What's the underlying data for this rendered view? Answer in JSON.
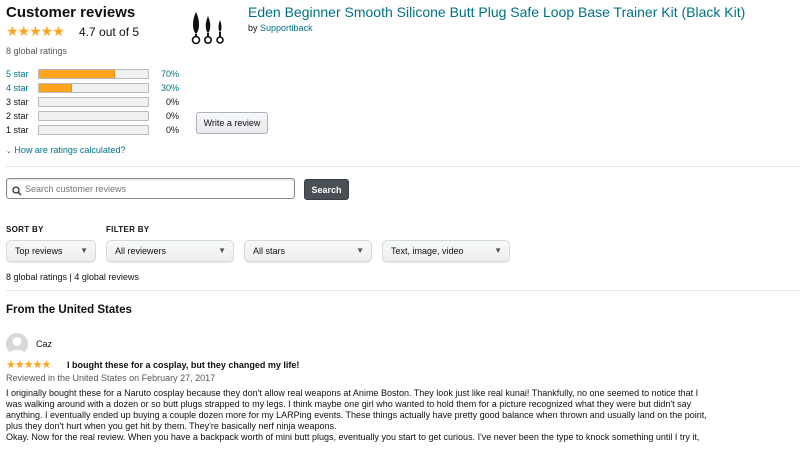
{
  "summary": {
    "title": "Customer reviews",
    "stars": "★★★★★",
    "rating_text": "4.7 out of 5",
    "global_ratings": "8 global ratings",
    "histogram": [
      {
        "label": "5 star",
        "pct": "70%",
        "fraction": 0.7,
        "link": true
      },
      {
        "label": "4 star",
        "pct": "30%",
        "fraction": 0.3,
        "link": true
      },
      {
        "label": "3 star",
        "pct": "0%",
        "fraction": 0,
        "link": false
      },
      {
        "label": "2 star",
        "pct": "0%",
        "fraction": 0,
        "link": false
      },
      {
        "label": "1 star",
        "pct": "0%",
        "fraction": 0,
        "link": false
      }
    ],
    "how_calculated": "How are ratings calculated?"
  },
  "product": {
    "title": "Eden Beginner Smooth Silicone Butt Plug Safe Loop Base Trainer Kit (Black Kit)",
    "by": "by",
    "brand": "Supportiback",
    "write_review": "Write a review"
  },
  "search": {
    "placeholder": "Search customer reviews",
    "button": "Search"
  },
  "filters": {
    "sort_by_label": "SORT BY",
    "filter_by_label": "FILTER BY",
    "sort_value": "Top reviews",
    "reviewers_value": "All reviewers",
    "stars_value": "All stars",
    "media_value": "Text, image, video",
    "count_text": "8 global ratings | 4 global reviews"
  },
  "section_title": "From the United States",
  "review": {
    "author": "Caz",
    "stars": "★★★★★",
    "title": "I bought these for a cosplay, but they changed my life!",
    "meta": "Reviewed in the United States on February 27, 2017",
    "line1": "I originally bought these for a Naruto cosplay because they don't allow real weapons at Anime Boston. They look just like real kunai! Thankfully, no one seemed to notice that I",
    "line2": "was walking around with a dozen or so butt plugs strapped to my legs. I think maybe one girl who wanted to hold them for a picture recognized what they were but didn't say",
    "line3": "anything. I eventually ended up buying a couple dozen more for my LARPing events. These things actually have pretty good balance when thrown and usually land on the point,",
    "line4": "plus they don't hurt when you get hit by them. They're basically nerf ninja weapons.",
    "line5": "Okay. Now for the real review. When you have a backpack worth of mini butt plugs, eventually you start to get curious. I've never been the type to knock something until I try it,"
  },
  "colors": {
    "star": "#ffa41c",
    "link": "#007185",
    "search_button": "#4a4f55"
  }
}
